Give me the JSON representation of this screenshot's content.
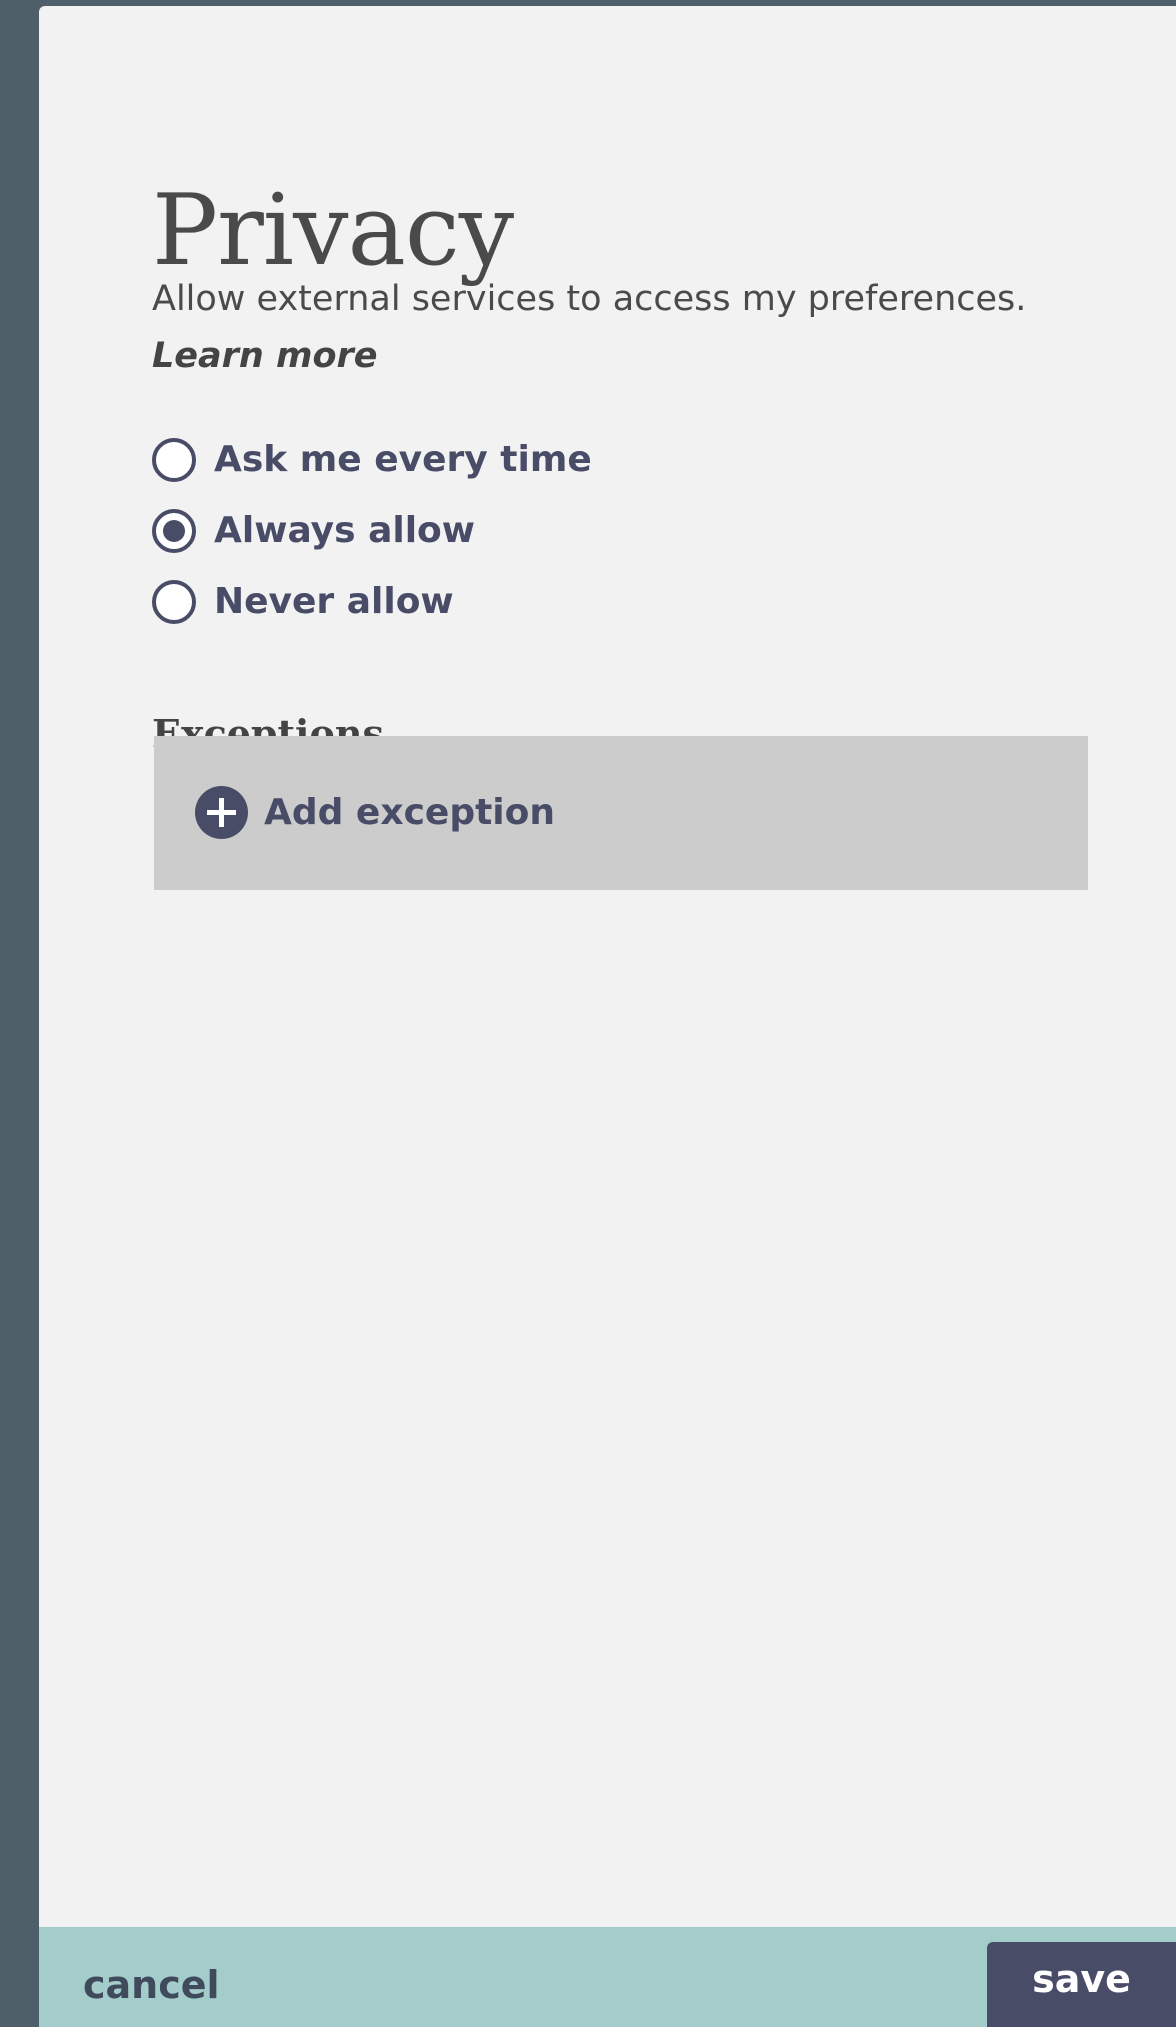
{
  "page": {
    "title": "Privacy",
    "description": "Allow external services to access my preferences.",
    "learn_more": "Learn more"
  },
  "permissions": {
    "options": [
      {
        "label": "Ask me every time",
        "checked": false
      },
      {
        "label": "Always allow",
        "checked": true
      },
      {
        "label": "Never allow",
        "checked": false
      }
    ]
  },
  "exceptions": {
    "title": "Exceptions",
    "add_label": "Add exception",
    "add_icon": "plus-circle-icon"
  },
  "footer": {
    "cancel_label": "cancel",
    "save_label": "save"
  },
  "colors": {
    "background": "#4f5f69",
    "panel": "#f2f2f2",
    "accent": "#484c67",
    "footer": "#a3ccca",
    "exceptions_box": "#cccccc"
  }
}
